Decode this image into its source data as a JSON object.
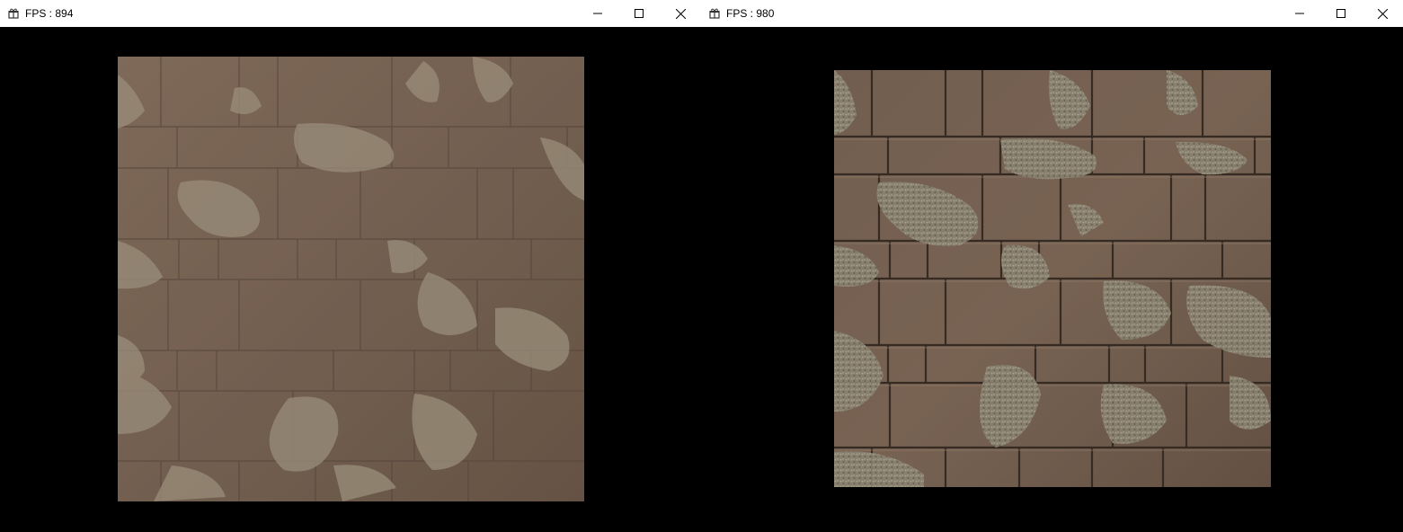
{
  "windows": [
    {
      "title": "FPS : 894",
      "controls": [
        "minimize-icon",
        "maximize-icon",
        "close-icon"
      ],
      "app_icon": "gift-icon"
    },
    {
      "title": "FPS : 980",
      "controls": [
        "minimize-icon",
        "maximize-icon",
        "close-icon"
      ],
      "app_icon": "gift-icon"
    }
  ],
  "colors": {
    "titlebar_bg": "#ffffff",
    "viewport_bg": "#000000",
    "stone_left": "#7d6756",
    "stone_right": "#7a6555",
    "moss": "#9c9583"
  }
}
